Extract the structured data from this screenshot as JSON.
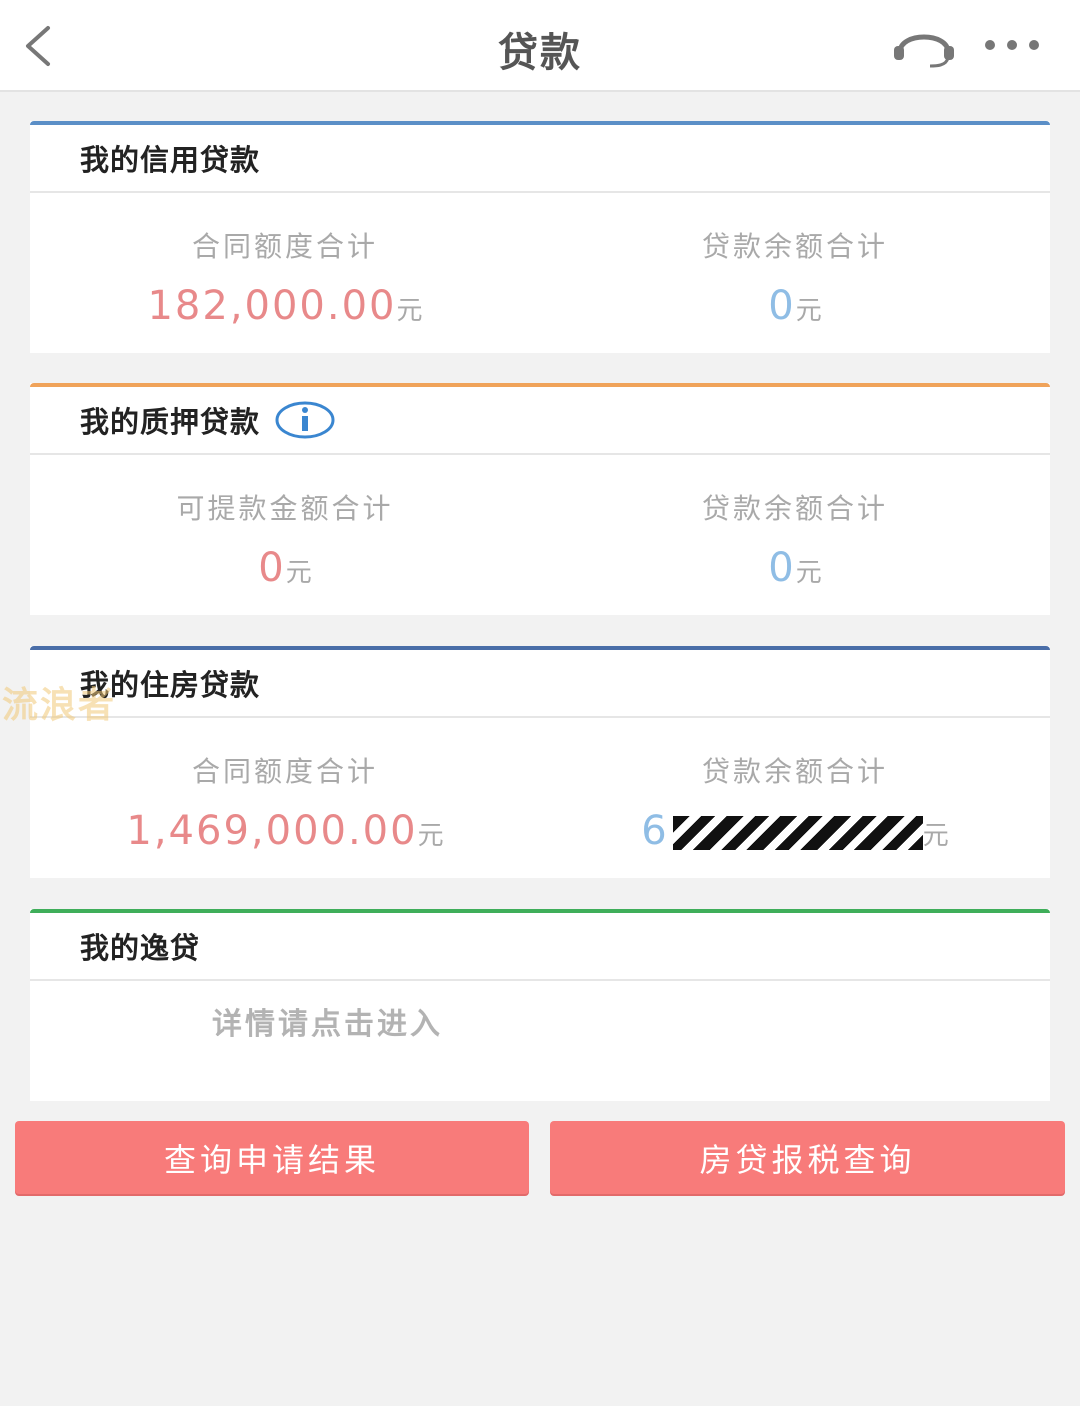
{
  "header": {
    "title": "贷款",
    "back_icon": "back-chevron-icon",
    "support_icon": "headset-icon",
    "more_icon": "more-dots-icon"
  },
  "credit_loan": {
    "title": "我的信用贷款",
    "accent_color": "#5b8fc7",
    "contract_label": "合同额度合计",
    "contract_value": "182,000.00",
    "contract_unit": "元",
    "balance_label": "贷款余额合计",
    "balance_value": "0",
    "balance_unit": "元"
  },
  "pledge_loan": {
    "title": "我的质押贷款",
    "accent_color": "#f0a35a",
    "info_icon": "info-icon",
    "withdraw_label": "可提款金额合计",
    "withdraw_value": "0",
    "withdraw_unit": "元",
    "balance_label": "贷款余额合计",
    "balance_value": "0",
    "balance_unit": "元"
  },
  "housing_loan": {
    "title": "我的住房贷款",
    "accent_color": "#4a6ea8",
    "contract_label": "合同额度合计",
    "contract_value": "1,469,000.00",
    "contract_unit": "元",
    "balance_label": "贷款余额合计",
    "balance_value_visible": "6",
    "balance_unit": "元"
  },
  "yidai": {
    "title": "我的逸贷",
    "accent_color": "#3fae5a",
    "hint": "详情请点击进入"
  },
  "buttons": {
    "query_application": "查询申请结果",
    "mortgage_tax_query": "房贷报税查询",
    "color": "#f87b7a"
  },
  "watermark": "流浪者"
}
